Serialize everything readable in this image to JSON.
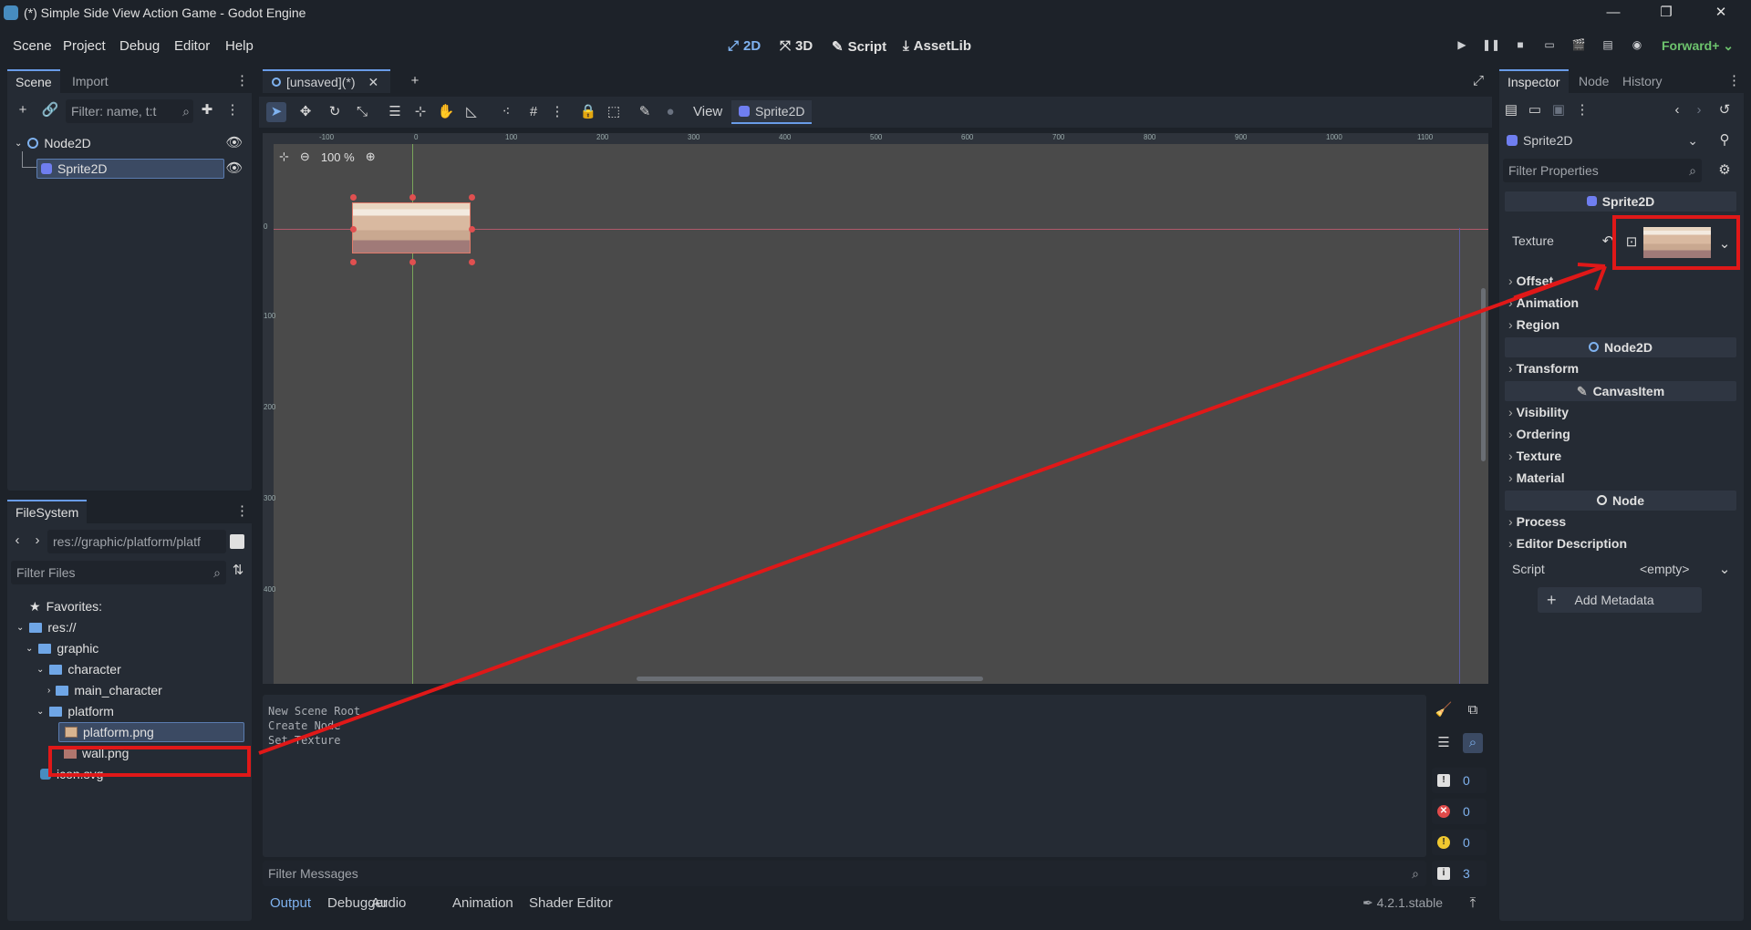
{
  "window": {
    "title": "(*) Simple Side View Action Game - Godot Engine"
  },
  "menu": [
    "Scene",
    "Project",
    "Debug",
    "Editor",
    "Help"
  ],
  "main_buttons": {
    "two_d": "2D",
    "three_d": "3D",
    "script": "Script",
    "assetlib": "AssetLib"
  },
  "renderer": "Forward+",
  "scene_dock": {
    "tabs": [
      "Scene",
      "Import"
    ],
    "filter_placeholder": "Filter: name, t:t",
    "nodes": [
      {
        "label": "Node2D"
      },
      {
        "label": "Sprite2D"
      }
    ]
  },
  "filesystem": {
    "tab": "FileSystem",
    "path": "res://graphic/platform/platf",
    "filter_placeholder": "Filter Files",
    "items": [
      {
        "label": "Favorites:"
      },
      {
        "label": "res://"
      },
      {
        "label": "graphic"
      },
      {
        "label": "character"
      },
      {
        "label": "main_character"
      },
      {
        "label": "platform"
      },
      {
        "label": "platform.png"
      },
      {
        "label": "wall.png"
      },
      {
        "label": "icon.svg"
      }
    ]
  },
  "editor": {
    "tab_label": "[unsaved](*)",
    "view_label": "View",
    "sprite_label": "Sprite2D",
    "zoom": "100 %",
    "ruler_h": [
      "-100",
      "0",
      "100",
      "200",
      "300",
      "400",
      "500",
      "600",
      "700",
      "800",
      "900",
      "1000",
      "1100"
    ],
    "ruler_v": [
      "0",
      "100",
      "200",
      "300",
      "400"
    ]
  },
  "output": {
    "lines": [
      "New Scene Root",
      "Create Node",
      "Set Texture"
    ],
    "filter_placeholder": "Filter Messages",
    "counts": {
      "messages": "0",
      "errors": "0",
      "warnings": "0",
      "info": "3"
    },
    "tabs": [
      "Output",
      "Debugger",
      "Audio",
      "Animation",
      "Shader Editor"
    ],
    "version": "4.2.1.stable"
  },
  "inspector": {
    "tabs": [
      "Inspector",
      "Node",
      "History"
    ],
    "object": "Sprite2D",
    "filter_placeholder": "Filter Properties",
    "section_sprite": "Sprite2D",
    "texture_label": "Texture",
    "sprite_props": [
      "Offset",
      "Animation",
      "Region"
    ],
    "section_node2d": "Node2D",
    "node2d_props": [
      "Transform"
    ],
    "section_canvas": "CanvasItem",
    "canvas_props": [
      "Visibility",
      "Ordering",
      "Texture",
      "Material"
    ],
    "section_node": "Node",
    "node_props": [
      "Process",
      "Editor Description"
    ],
    "script_label": "Script",
    "script_value": "<empty>",
    "add_metadata": "Add Metadata"
  },
  "colors": {
    "accent": "#699ce8",
    "highlight": "#e01818",
    "panel": "#252b34",
    "background": "#1d2229"
  }
}
